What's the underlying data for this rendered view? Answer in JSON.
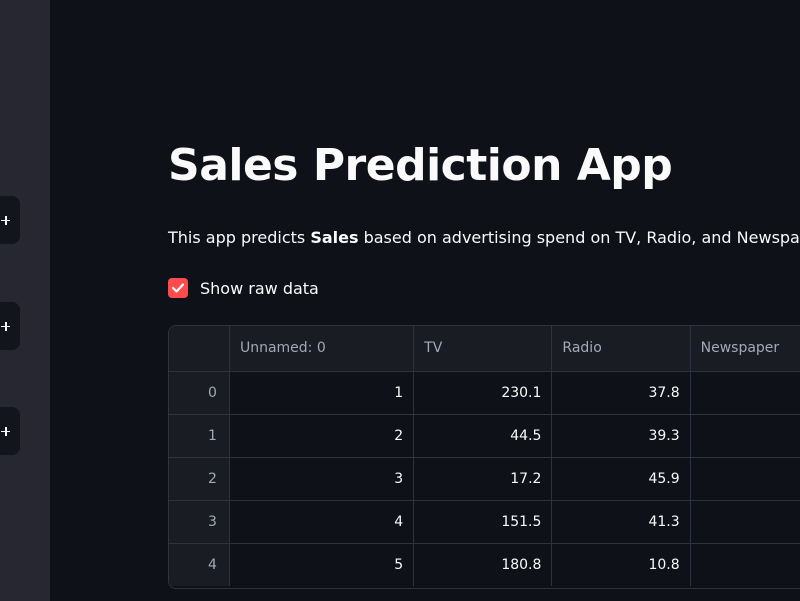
{
  "sidebar": {
    "buttons": [
      {
        "icon": "plus-icon"
      },
      {
        "icon": "plus-icon"
      },
      {
        "icon": "plus-icon"
      }
    ]
  },
  "main": {
    "title": "Sales Prediction App",
    "description": {
      "prefix": "This app predicts ",
      "bold": "Sales",
      "suffix": " based on advertising spend on TV, Radio, and Newspa"
    },
    "checkbox": {
      "label": "Show raw data",
      "checked": true,
      "color": "#ff4b4b"
    },
    "table": {
      "columns": [
        "Unnamed: 0",
        "TV",
        "Radio",
        "Newspaper"
      ],
      "rows": [
        {
          "index": "0",
          "cells": [
            "1",
            "230.1",
            "37.8",
            ""
          ]
        },
        {
          "index": "1",
          "cells": [
            "2",
            "44.5",
            "39.3",
            ""
          ]
        },
        {
          "index": "2",
          "cells": [
            "3",
            "17.2",
            "45.9",
            ""
          ]
        },
        {
          "index": "3",
          "cells": [
            "4",
            "151.5",
            "41.3",
            ""
          ]
        },
        {
          "index": "4",
          "cells": [
            "5",
            "180.8",
            "10.8",
            ""
          ]
        }
      ]
    }
  },
  "colors": {
    "background": "#0e1117",
    "sidebar": "#262730",
    "accent": "#ff4b4b"
  }
}
